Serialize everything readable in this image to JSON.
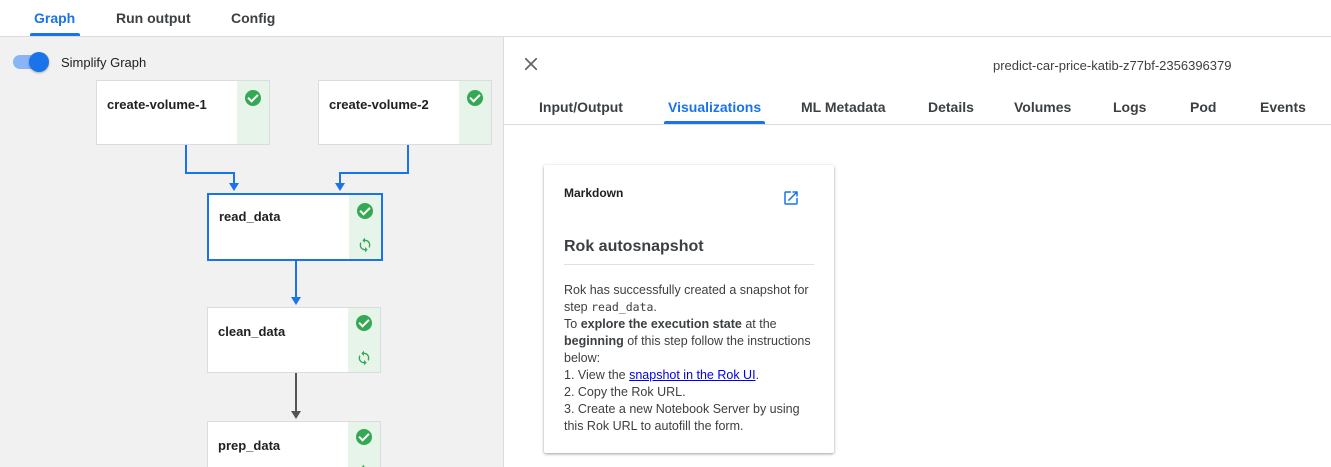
{
  "top_tabs": [
    {
      "label": "Graph",
      "active": true
    },
    {
      "label": "Run output",
      "active": false
    },
    {
      "label": "Config",
      "active": false
    }
  ],
  "graph": {
    "simplify_label": "Simplify Graph",
    "simplify_enabled": true,
    "nodes": [
      {
        "name": "create-volume-1",
        "status": "succeeded"
      },
      {
        "name": "create-volume-2",
        "status": "succeeded"
      },
      {
        "name": "read_data",
        "status": "succeeded",
        "snapshot": true,
        "selected": true
      },
      {
        "name": "clean_data",
        "status": "succeeded",
        "snapshot": true
      },
      {
        "name": "prep_data",
        "status": "succeeded",
        "snapshot": true
      }
    ]
  },
  "details": {
    "run_id": "predict-car-price-katib-z77bf-2356396379",
    "tabs": [
      {
        "label": "Input/Output",
        "active": false
      },
      {
        "label": "Visualizations",
        "active": true
      },
      {
        "label": "ML Metadata",
        "active": false
      },
      {
        "label": "Details",
        "active": false
      },
      {
        "label": "Volumes",
        "active": false
      },
      {
        "label": "Logs",
        "active": false
      },
      {
        "label": "Pod",
        "active": false
      },
      {
        "label": "Events",
        "active": false
      }
    ],
    "card": {
      "title": "Markdown",
      "heading": "Rok autosnapshot",
      "line1": "Rok has successfully created a snapshot for step ",
      "step_code": "read_data",
      "line1_end": ".",
      "line2_pre": "To ",
      "line2_bold1": "explore the execution state",
      "line2_mid": " at the ",
      "line2_bold2": "beginning",
      "line2_post": " of this step follow the instructions below:",
      "step1_pre": "1. View the ",
      "step1_link": "snapshot in the Rok UI",
      "step1_post": ".",
      "step2": "2. Copy the Rok URL.",
      "step3": "3. Create a new Notebook Server by using this Rok URL to autofill the form."
    }
  },
  "colors": {
    "accent": "#1a73e8",
    "success": "#34a853",
    "success_bg": "#e6f4ea"
  }
}
